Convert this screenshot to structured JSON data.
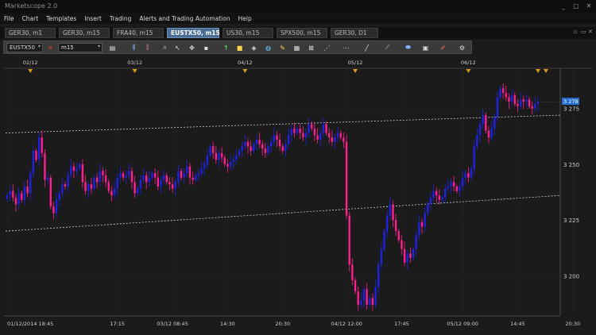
{
  "app": {
    "title": "Marketscope 2.0"
  },
  "window_controls": [
    "_",
    "□",
    "✕"
  ],
  "menu": [
    "File",
    "Chart",
    "Templates",
    "Insert",
    "Trading",
    "Alerts and Trading Automation",
    "Help"
  ],
  "tabs": [
    {
      "label": "GER30, m1",
      "active": false
    },
    {
      "label": "GER30, m15",
      "active": false
    },
    {
      "label": "FRA40, m15",
      "active": false
    },
    {
      "label": "EUSTX50, m15",
      "active": true
    },
    {
      "label": "US30, m15",
      "active": false
    },
    {
      "label": "SPX500, m15",
      "active": false
    },
    {
      "label": "GER30, D1",
      "active": false
    }
  ],
  "toolbar": {
    "instrument": "EUSTX50",
    "timeframe": "m15",
    "icons": [
      "chart-type-icon",
      "bar-style-icon",
      "candle-style-icon",
      "zoom-icon",
      "cursor-icon",
      "crosshair-icon",
      "square-icon",
      "arrow-up-icon",
      "rectangle-icon",
      "ellipse-icon",
      "fibonacci-icon",
      "pencil-icon",
      "text-icon",
      "delete-icon",
      "channel-icon",
      "line-icon",
      "trendline-icon",
      "shape-icon",
      "eraser-icon",
      "settings-icon"
    ]
  },
  "colors": {
    "bull": "#1f22e0",
    "bear": "#ff1f8f",
    "background": "#1b1b1b",
    "grid": "#3a3a3a",
    "price_tag": "#2a6fd6"
  },
  "chart_data": {
    "type": "candlestick",
    "instrument": "EUSTX50",
    "timeframe": "m15",
    "ylim": [
      3182,
      3293
    ],
    "y_ticks": [
      "3 200",
      "3 225",
      "3 250",
      "3 275"
    ],
    "y_tick_values": [
      3200,
      3225,
      3250,
      3275
    ],
    "current_price": "3 278",
    "current_price_value": 3278,
    "top_dates": [
      "02/12",
      "03/12",
      "04/12",
      "05/12",
      "06/12"
    ],
    "x_labels": [
      "01/12/2014 18:45",
      "17:15",
      "03/12 08:45",
      "14:30",
      "20:30",
      "04/12 12:00",
      "17:45",
      "05/12 09:00",
      "14:45",
      "20:30"
    ],
    "x_label_index": [
      0,
      38,
      57,
      76,
      95,
      117,
      136,
      157,
      176,
      195
    ],
    "channel_upper": {
      "start": 3264,
      "end": 3272
    },
    "channel_lower": {
      "start": 3220,
      "end": 3236
    },
    "closes": [
      3236,
      3238,
      3235,
      3232,
      3237,
      3234,
      3240,
      3237,
      3246,
      3256,
      3252,
      3262,
      3255,
      3243,
      3244,
      3231,
      3228,
      3234,
      3237,
      3241,
      3240,
      3245,
      3249,
      3247,
      3248,
      3250,
      3242,
      3238,
      3241,
      3239,
      3244,
      3242,
      3247,
      3245,
      3242,
      3238,
      3236,
      3239,
      3244,
      3246,
      3244,
      3245,
      3247,
      3242,
      3237,
      3239,
      3243,
      3245,
      3242,
      3244,
      3246,
      3244,
      3240,
      3243,
      3245,
      3242,
      3241,
      3239,
      3242,
      3247,
      3244,
      3246,
      3249,
      3244,
      3243,
      3245,
      3246,
      3248,
      3250,
      3254,
      3258,
      3255,
      3252,
      3255,
      3253,
      3250,
      3249,
      3251,
      3252,
      3254,
      3256,
      3258,
      3260,
      3258,
      3256,
      3259,
      3261,
      3259,
      3257,
      3255,
      3258,
      3260,
      3263,
      3261,
      3258,
      3256,
      3259,
      3263,
      3266,
      3264,
      3266,
      3264,
      3262,
      3264,
      3268,
      3266,
      3263,
      3261,
      3264,
      3268,
      3264,
      3262,
      3260,
      3262,
      3264,
      3262,
      3260,
      3227,
      3205,
      3198,
      3193,
      3187,
      3189,
      3194,
      3187,
      3190,
      3187,
      3195,
      3205,
      3212,
      3220,
      3227,
      3232,
      3225,
      3220,
      3216,
      3212,
      3206,
      3210,
      3208,
      3212,
      3218,
      3224,
      3222,
      3228,
      3232,
      3235,
      3238,
      3236,
      3234,
      3235,
      3239,
      3240,
      3242,
      3240,
      3238,
      3240,
      3244,
      3246,
      3244,
      3248,
      3258,
      3263,
      3268,
      3272,
      3265,
      3262,
      3266,
      3271,
      3280,
      3284,
      3282,
      3280,
      3278,
      3281,
      3277,
      3276,
      3279,
      3278,
      3279,
      3276,
      3275,
      3277,
      3278
    ]
  }
}
